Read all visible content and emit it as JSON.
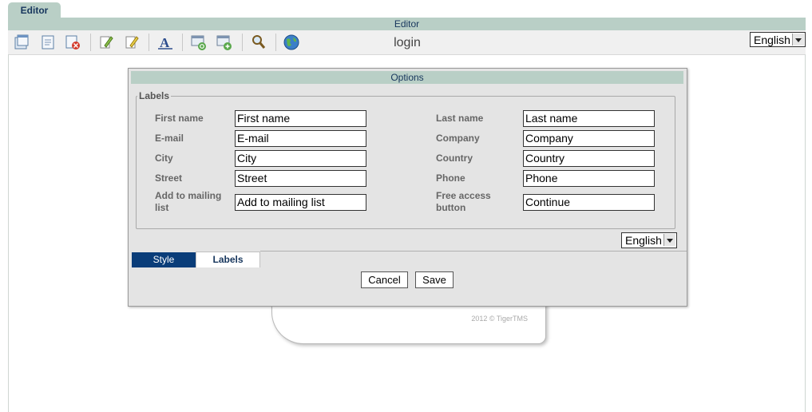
{
  "editor_tab": "Editor",
  "editor_bar_title": "Editor",
  "page_name": "login",
  "toolbar": {
    "icons": [
      "new-page-icon",
      "edit-page-icon",
      "delete-page-icon",
      "edit-icon",
      "edit-alt-icon",
      "font-icon",
      "window-refresh-icon",
      "window-add-icon",
      "search-icon",
      "globe-icon"
    ]
  },
  "language_select": "English",
  "dialog": {
    "title": "Options",
    "legend": "Labels",
    "fields_left": [
      {
        "label": "First name",
        "value": "First name"
      },
      {
        "label": "E-mail",
        "value": "E-mail"
      },
      {
        "label": "City",
        "value": "City"
      },
      {
        "label": "Street",
        "value": "Street"
      },
      {
        "label": "Add to mailing list",
        "value": "Add to mailing list"
      }
    ],
    "fields_right": [
      {
        "label": "Last name",
        "value": "Last name"
      },
      {
        "label": "Company",
        "value": "Company"
      },
      {
        "label": "Country",
        "value": "Country"
      },
      {
        "label": "Phone",
        "value": "Phone"
      },
      {
        "label": "Free access button",
        "value": "Continue"
      }
    ],
    "language_select": "English",
    "tabs": [
      "Style",
      "Labels"
    ],
    "cancel": "Cancel",
    "save": "Save"
  },
  "copyright": "2012 © TigerTMS",
  "colors": {
    "header": "#b9cfc6",
    "active_tab": "#0a3d79",
    "title_text": "#17365d"
  }
}
